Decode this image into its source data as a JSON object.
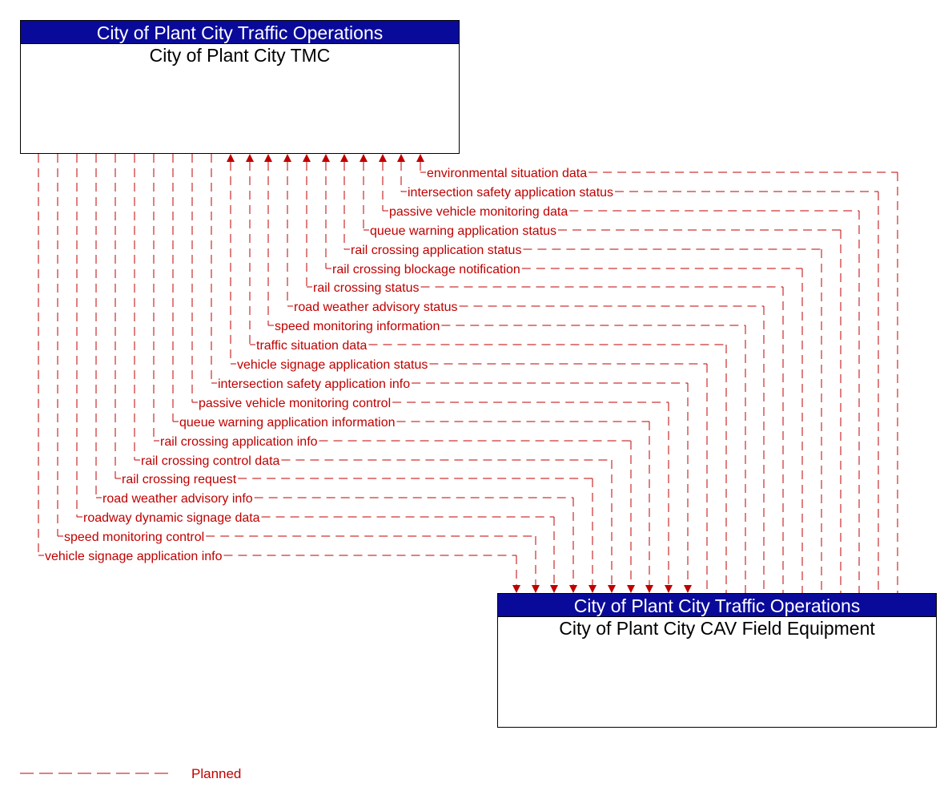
{
  "diagram": {
    "line_color": "#c00000",
    "header_color": "#0a0a9a",
    "nodes": {
      "top": {
        "header": "City of Plant City Traffic Operations",
        "title": "City of Plant City TMC"
      },
      "bottom": {
        "header": "City of Plant City Traffic Operations",
        "title": "City of Plant City CAV Field Equipment"
      }
    },
    "flows": [
      {
        "label": "environmental situation data",
        "direction": "to_top",
        "status": "Planned"
      },
      {
        "label": "intersection safety application status",
        "direction": "to_top",
        "status": "Planned"
      },
      {
        "label": "passive vehicle monitoring data",
        "direction": "to_top",
        "status": "Planned"
      },
      {
        "label": "queue warning application status",
        "direction": "to_top",
        "status": "Planned"
      },
      {
        "label": "rail crossing application status",
        "direction": "to_top",
        "status": "Planned"
      },
      {
        "label": "rail crossing blockage notification",
        "direction": "to_top",
        "status": "Planned"
      },
      {
        "label": "rail crossing status",
        "direction": "to_top",
        "status": "Planned"
      },
      {
        "label": "road weather advisory status",
        "direction": "to_top",
        "status": "Planned"
      },
      {
        "label": "speed monitoring information",
        "direction": "to_top",
        "status": "Planned"
      },
      {
        "label": "traffic situation data",
        "direction": "to_top",
        "status": "Planned"
      },
      {
        "label": "vehicle signage application status",
        "direction": "to_top",
        "status": "Planned"
      },
      {
        "label": "intersection safety application info",
        "direction": "to_bottom",
        "status": "Planned"
      },
      {
        "label": "passive vehicle monitoring control",
        "direction": "to_bottom",
        "status": "Planned"
      },
      {
        "label": "queue warning application information",
        "direction": "to_bottom",
        "status": "Planned"
      },
      {
        "label": "rail crossing application info",
        "direction": "to_bottom",
        "status": "Planned"
      },
      {
        "label": "rail crossing control data",
        "direction": "to_bottom",
        "status": "Planned"
      },
      {
        "label": "rail crossing request",
        "direction": "to_bottom",
        "status": "Planned"
      },
      {
        "label": "road weather advisory info",
        "direction": "to_bottom",
        "status": "Planned"
      },
      {
        "label": "roadway dynamic signage data",
        "direction": "to_bottom",
        "status": "Planned"
      },
      {
        "label": "speed monitoring control",
        "direction": "to_bottom",
        "status": "Planned"
      },
      {
        "label": "vehicle signage application info",
        "direction": "to_bottom",
        "status": "Planned"
      }
    ],
    "legend": [
      {
        "label": "Planned",
        "style": "dashed"
      }
    ]
  }
}
